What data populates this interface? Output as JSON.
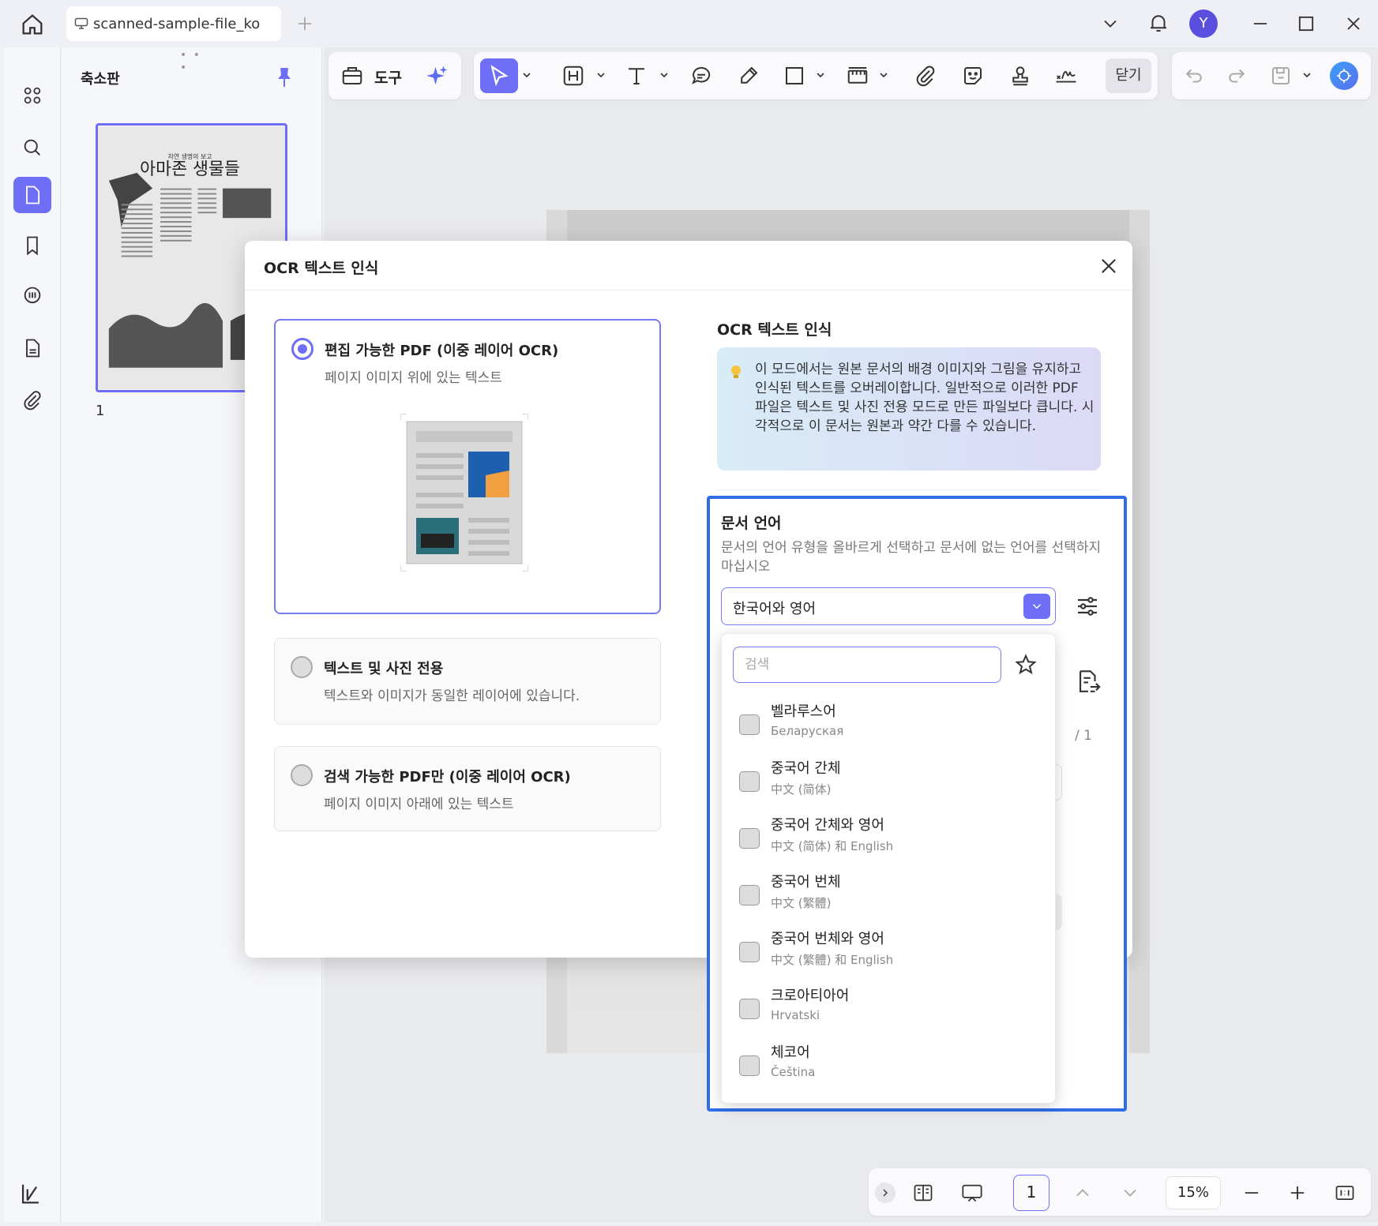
{
  "titlebar": {
    "tab_label": "scanned-sample-file_ko",
    "avatar_letter": "Y"
  },
  "thumbnails": {
    "title": "축소판",
    "page_number": "1",
    "thumb_headline": "아마존 생물들",
    "thumb_kicker": "자연 생명의 보고"
  },
  "toolbar": {
    "tools_label": "도구",
    "close_label": "닫기"
  },
  "dialog": {
    "title": "OCR 텍스트 인식",
    "options": [
      {
        "title": "편집 가능한 PDF (이중 레이어 OCR)",
        "subtitle": "페이지 이미지 위에 있는 텍스트",
        "selected": true
      },
      {
        "title": "텍스트 및 사진 전용",
        "subtitle": "텍스트와 이미지가 동일한 레이어에 있습니다.",
        "selected": false
      },
      {
        "title": "검색 가능한 PDF만 (이중 레이어 OCR)",
        "subtitle": "페이지 이미지 아래에 있는 텍스트",
        "selected": false
      }
    ],
    "right_title": "OCR 텍스트 인식",
    "info": "이 모드에서는 원본 문서의 배경 이미지와 그림을 유지하고 인식된 텍스트를 오버레이합니다. 일반적으로 이러한 PDF 파일은 텍스트 및 사진 전용 모드로 만든 파일보다 큽니다. 시각적으로 이 문서는 원본과 약간 다를 수 있습니다.",
    "language": {
      "title": "문서 언어",
      "description": "문서의 언어 유형을 올바르게 선택하고 문서에 없는 언어를 선택하지 마십시오",
      "selected": "한국어와 영어",
      "search_placeholder": "검색",
      "page_total": "/ 1",
      "items": [
        {
          "name": "벨라루스어",
          "native": "Беларуская",
          "checked": false
        },
        {
          "name": "중국어 간체",
          "native": "中文 (简体)",
          "checked": false
        },
        {
          "name": "중국어 간체와 영어",
          "native": "中文 (简体) 和 English",
          "checked": false
        },
        {
          "name": "중국어 번체",
          "native": "中文 (繁體)",
          "checked": false
        },
        {
          "name": "중국어 번체와 영어",
          "native": "中文 (繁體) 和 English",
          "checked": false
        },
        {
          "name": "크로아티아어",
          "native": "Hrvatski",
          "checked": false
        },
        {
          "name": "체코어",
          "native": "Čeština",
          "checked": false
        }
      ]
    }
  },
  "bottombar": {
    "page_value": "1",
    "zoom": "15%"
  },
  "colors": {
    "accent": "#6e6ef7",
    "highlight": "#2f6ee8"
  }
}
